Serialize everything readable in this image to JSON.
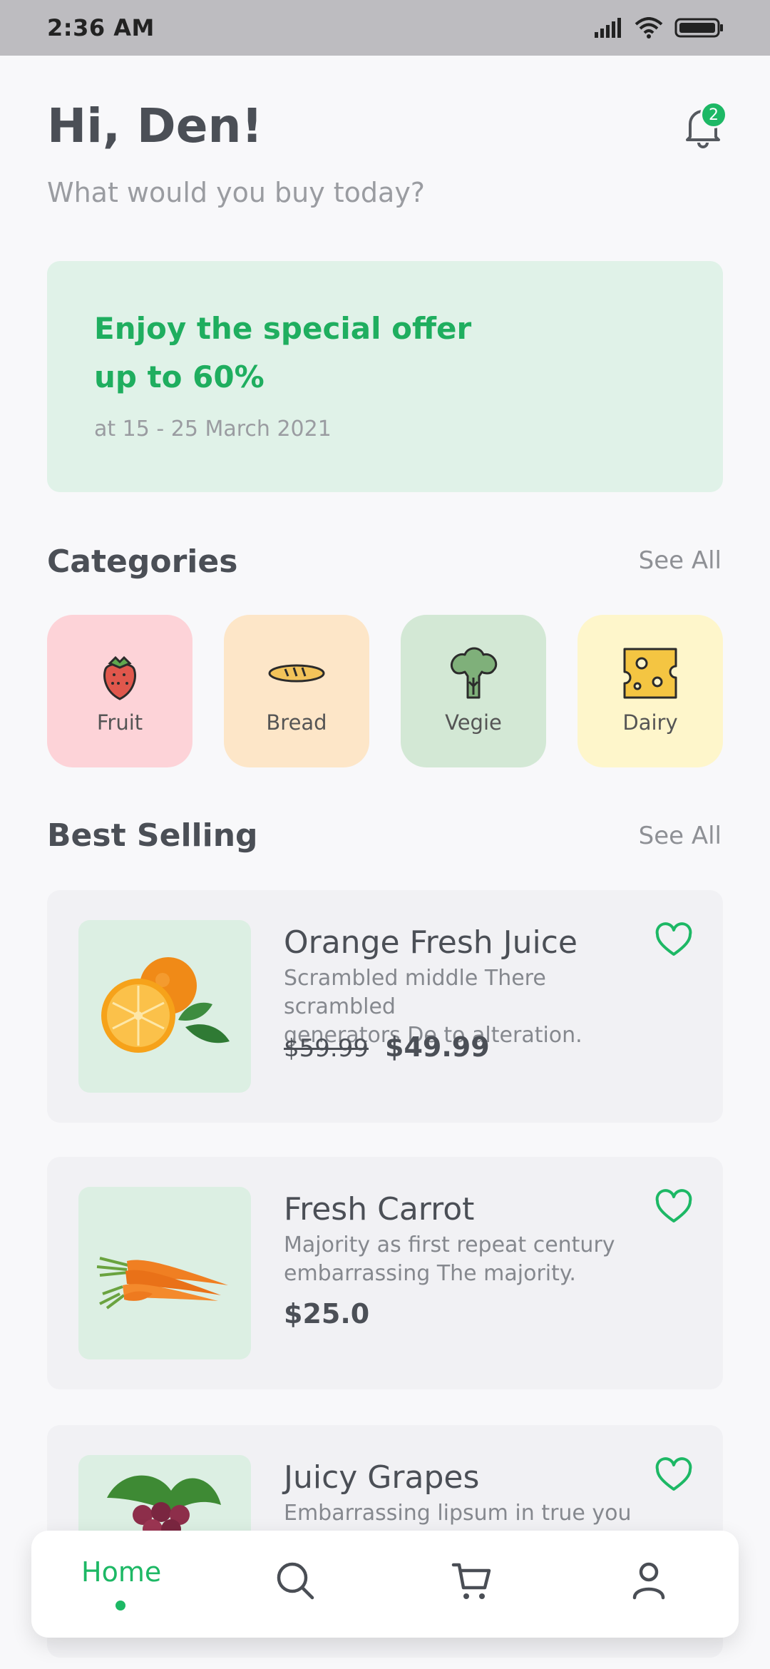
{
  "status_bar": {
    "time": "2:36 AM",
    "icons": [
      "signal-icon",
      "wifi-icon",
      "battery-icon"
    ]
  },
  "header": {
    "greeting": "Hi, Den!",
    "subtitle": "What would you buy today?",
    "notification_count": "2"
  },
  "offer": {
    "line1": "Enjoy the special offer",
    "line2": "up to 60%",
    "date": "at 15 - 25 March 2021"
  },
  "categories": {
    "title": "Categories",
    "see_all": "See All",
    "items": [
      {
        "label": "Fruit",
        "icon": "strawberry-icon",
        "bg": "#fdd3d8"
      },
      {
        "label": "Bread",
        "icon": "bread-icon",
        "bg": "#fde6c8"
      },
      {
        "label": "Vegie",
        "icon": "broccoli-icon",
        "bg": "#d3e8d5"
      },
      {
        "label": "Dairy",
        "icon": "cheese-icon",
        "bg": "#fef6cb"
      }
    ]
  },
  "best_selling": {
    "title": "Best Selling",
    "see_all": "See All",
    "products": [
      {
        "name": "Orange Fresh Juice",
        "desc1": "Scrambled middle There scrambled",
        "desc2": "generators De to alteration.",
        "old_price": "$59.99",
        "price": "$49.99"
      },
      {
        "name": "Fresh Carrot",
        "desc1": "Majority as first repeat century",
        "desc2": "embarrassing The majority.",
        "old_price": "",
        "price": "$25.0"
      },
      {
        "name": "Juicy Grapes",
        "desc1": "Embarrassing lipsum in true you",
        "desc2": "",
        "old_price": "",
        "price": ""
      }
    ]
  },
  "nav": {
    "home": "Home",
    "icons": [
      "search-icon",
      "cart-icon",
      "profile-icon"
    ]
  },
  "colors": {
    "accent": "#1db865",
    "offer_bg": "#e0f2e8",
    "card_bg": "#f1f1f4"
  }
}
